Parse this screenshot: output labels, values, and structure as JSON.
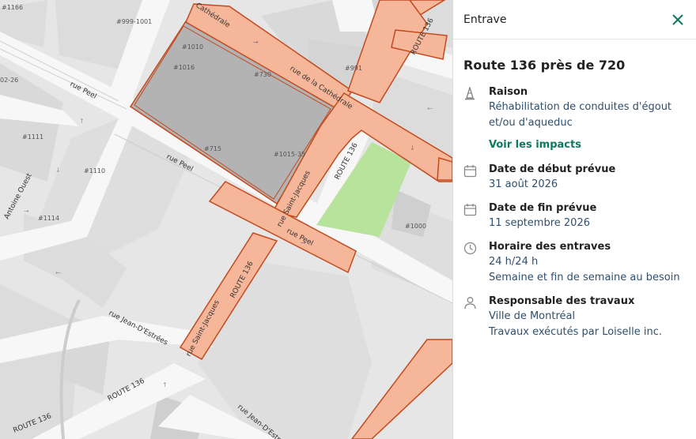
{
  "panel": {
    "header_title": "Entrave",
    "title": "Route 136 près de 720",
    "sections": {
      "raison": {
        "title": "Raison",
        "value": "Réhabilitation de conduites d'égout et/ou d'aqueduc",
        "link": "Voir les impacts"
      },
      "debut": {
        "title": "Date de début prévue",
        "value": "31 août 2026"
      },
      "fin": {
        "title": "Date de fin prévue",
        "value": "11 septembre 2026"
      },
      "horaire": {
        "title": "Horaire des entraves",
        "value1": "24 h/24 h",
        "value2": "Semaine et fin de semaine au besoin"
      },
      "responsable": {
        "title": "Responsable des travaux",
        "value1": "Ville de Montréal",
        "value2": "Travaux exécutés par Loiselle inc."
      }
    },
    "colors": {
      "accent": "#0d7a5f",
      "value_text": "#2f4f6e"
    }
  },
  "map": {
    "streets": {
      "peel_1": "rue Peel",
      "peel_2": "rue Peel",
      "peel_3": "rue Peel",
      "cathedrale": "rue de la Cathédrale",
      "cathedrale_top": "Cathédrale",
      "route136_a": "ROUTE 136",
      "route136_b": "ROUTE 136",
      "route136_c": "ROUTE 136",
      "route136_d": "ROUTE 136",
      "route136_e": "ROUTE 136",
      "st_jacques_1": "rue Saint-Jacques",
      "st_jacques_2": "rue Saint-Jacques",
      "jean_destrees_1": "rue Jean-D'Estrées",
      "jean_destrees_2": "rue Jean-D'Estrées",
      "antoine": "Antoine Ouest"
    },
    "addresses": {
      "a1166": "#1166",
      "a999": "#999-1001",
      "a1010": "#1010",
      "a1016": "#1016",
      "a730": "#730",
      "a991": "#991",
      "a2026": "02-26",
      "a1111": "#1111",
      "a715": "#715",
      "a1015": "#1015-35",
      "a1110": "#1110",
      "a1114": "#1114",
      "a1000": "#1000"
    },
    "colors": {
      "closure_fill": "#f6b699",
      "closure_stroke": "#c24a1d",
      "park": "#b8e39c"
    }
  }
}
